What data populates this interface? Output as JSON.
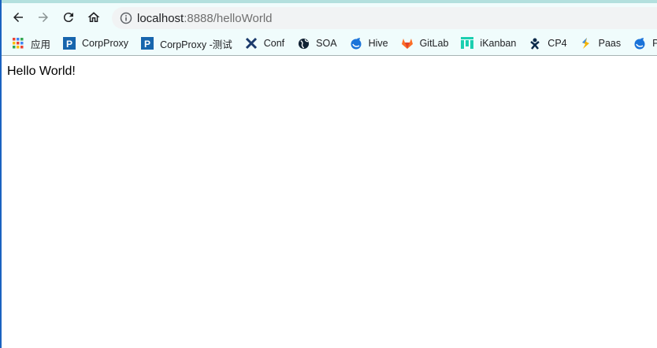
{
  "browser": {
    "url_host": "localhost",
    "url_rest": ":8888/helloWorld",
    "bookmarks": [
      {
        "label": "应用",
        "icon": "apps-grid-icon"
      },
      {
        "label": "CorpProxy",
        "icon": "p-logo-icon"
      },
      {
        "label": "CorpProxy -测试",
        "icon": "p-logo-icon"
      },
      {
        "label": "Conf",
        "icon": "confluence-icon"
      },
      {
        "label": "SOA",
        "icon": "globe-icon"
      },
      {
        "label": "Hive",
        "icon": "hive-dolphin-icon"
      },
      {
        "label": "GitLab",
        "icon": "gitlab-icon"
      },
      {
        "label": "iKanban",
        "icon": "kanban-icon"
      },
      {
        "label": "CP4",
        "icon": "jenkins-icon"
      },
      {
        "label": "Paas",
        "icon": "paas-icon"
      },
      {
        "label": "P",
        "icon": "hive-dolphin-icon"
      }
    ]
  },
  "page": {
    "text": "Hello World!"
  }
}
